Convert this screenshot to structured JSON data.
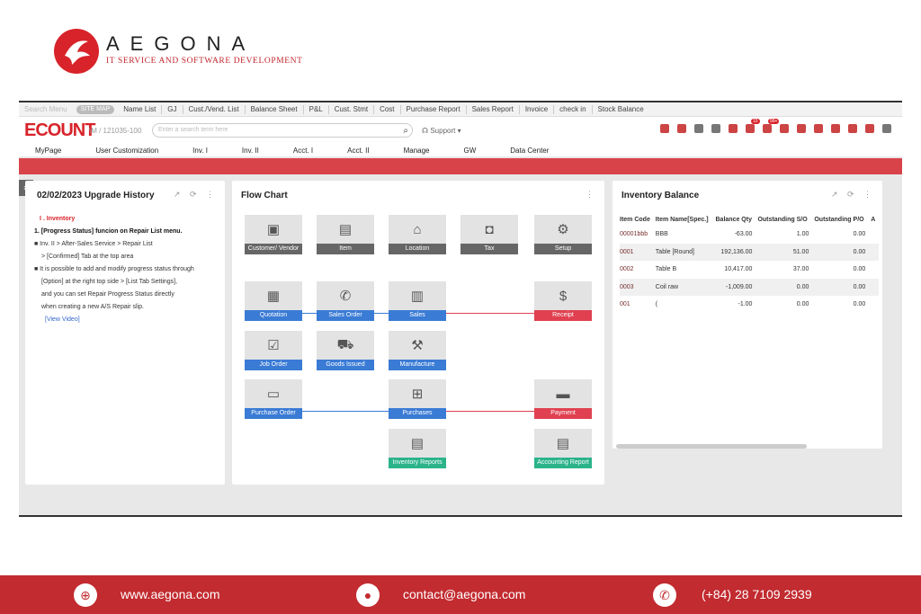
{
  "brand": {
    "name": "AEGONA",
    "tagline": "IT SERVICE AND SOFTWARE DEVELOPMENT",
    "accent": "#d8232a"
  },
  "topbar": {
    "search_placeholder": "Search Menu",
    "pill": "SITE MAP",
    "links": [
      "Name List",
      "GJ",
      "Cust./Vend. List",
      "Balance Sheet",
      "P&L",
      "Cust. Stmt",
      "Cost",
      "Purchase Report",
      "Sales Report",
      "Invoice",
      "check in",
      "Stock Balance"
    ]
  },
  "app": {
    "logo": "ECOUNT",
    "account": "\\M / 121035-100",
    "search_placeholder": "Enter a search term here",
    "support": "Support ▾",
    "badges": {
      "alert": "15",
      "chat": "99+"
    },
    "menu": [
      "MyPage",
      "User Customization",
      "Inv. I",
      "Inv. II",
      "Acct. I",
      "Acct. II",
      "Manage",
      "GW",
      "Data Center"
    ]
  },
  "history": {
    "title": "02/02/2023 Upgrade History",
    "section": "I . Inventory",
    "heading": "1. [Progress Status] funcion on Repair List menu.",
    "line1": "■ Inv. II > After-Sales Service > Repair List",
    "line2": "> [Confirmed] Tab at the top area",
    "line3": "■ It is possible to add and modify progress status through",
    "line4": "[Option] at the right top side > [List Tab Settings],",
    "line5": "and you can set Repair Progress Status directly",
    "line6": "when creating a new A/S Repair slip.",
    "link": "[View Video]"
  },
  "flow": {
    "title": "Flow Chart",
    "nodes": {
      "customer": "Customer/ Vendor",
      "item": "Item",
      "location": "Location",
      "tax": "Tax",
      "setup": "Setup",
      "quotation": "Quotation",
      "sales_order": "Sales Order",
      "sales": "Sales",
      "receipt": "Receipt",
      "job_order": "Job Order",
      "goods_issued": "Goods Issued",
      "manufacture": "Manufacture",
      "purchase_order": "Purchase Order",
      "purchases": "Purchases",
      "payment": "Payment",
      "inventory_reports": "Inventory Reports",
      "accounting_report": "Accounting Report"
    }
  },
  "inventory": {
    "title": "Inventory Balance",
    "headers": [
      "Item Code",
      "Item Name[Spec.]",
      "Balance Qty",
      "Outstanding S/O",
      "Outstanding P/O",
      "A"
    ],
    "rows": [
      [
        "00001bbb",
        "BBB",
        "-63.00",
        "1.00",
        "0.00"
      ],
      [
        "0001",
        "Table [Round]",
        "192,136.00",
        "51.00",
        "0.00"
      ],
      [
        "0002",
        "Table B",
        "10,417.00",
        "37.00",
        "0.00"
      ],
      [
        "0003",
        "Coil raw",
        "-1,009.00",
        "0.00",
        "0.00"
      ],
      [
        "001",
        "(",
        "-1.00",
        "0.00",
        "0.00"
      ]
    ]
  },
  "footer": {
    "web": "www.aegona.com",
    "email": "contact@aegona.com",
    "phone": "(+84) 28 7109 2939",
    "color": "#c22b30"
  }
}
